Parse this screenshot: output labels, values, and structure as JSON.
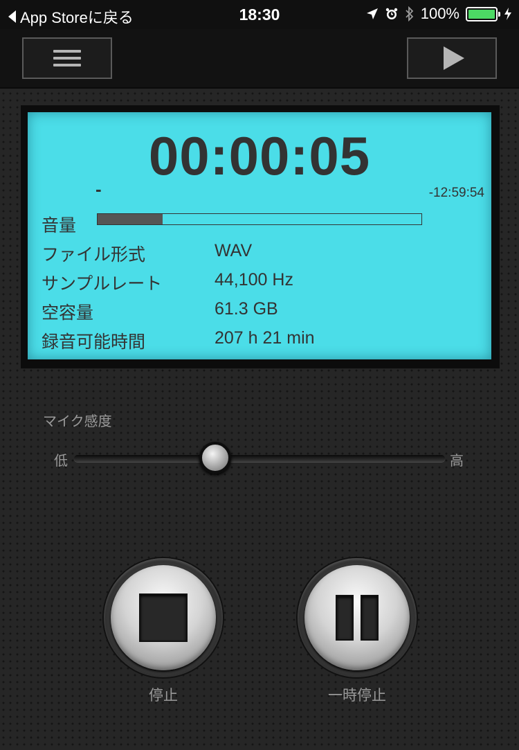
{
  "status_bar": {
    "back_label": "App Storeに戻る",
    "time": "18:30",
    "battery": "100%",
    "icons": [
      "location-icon",
      "alarm-icon",
      "bluetooth-icon",
      "battery-icon",
      "charging-icon"
    ]
  },
  "toolbar": {
    "menu_icon": "hamburger-menu-icon",
    "play_icon": "play-icon"
  },
  "display": {
    "elapsed": "00:00:05",
    "level_indicator": "-",
    "remaining": "-12:59:54",
    "volume_label": "音量",
    "volume_level": 0.2,
    "rows": [
      {
        "label": "ファイル形式",
        "value": "WAV"
      },
      {
        "label": "サンプルレート",
        "value": "44,100 Hz"
      },
      {
        "label": "空容量",
        "value": "61.3 GB"
      },
      {
        "label": "録音可能時間",
        "value": "207 h 21 min"
      }
    ]
  },
  "mic": {
    "label": "マイク感度",
    "low": "低",
    "high": "高",
    "sensitivity": 0.38
  },
  "controls": {
    "stop_label": "停止",
    "pause_label": "一時停止"
  },
  "colors": {
    "lcd": "#4bdde8",
    "battery": "#4cd964",
    "background": "#262626"
  }
}
